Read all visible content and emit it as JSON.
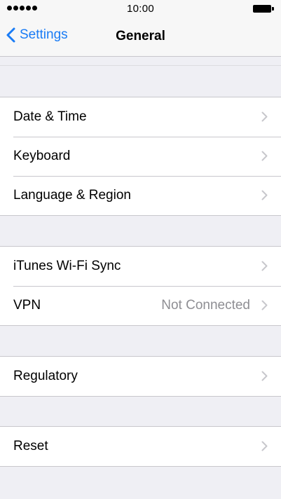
{
  "status_bar": {
    "time": "10:00",
    "signal_icon": "signal-dots-icon",
    "battery_icon": "battery-icon"
  },
  "nav": {
    "back_label": "Settings",
    "back_icon": "chevron-left-icon",
    "title": "General",
    "accent_color": "#1a7cf5"
  },
  "groups": [
    {
      "rows": [
        {
          "label": "Date & Time",
          "value": ""
        },
        {
          "label": "Keyboard",
          "value": ""
        },
        {
          "label": "Language & Region",
          "value": ""
        }
      ]
    },
    {
      "rows": [
        {
          "label": "iTunes Wi-Fi Sync",
          "value": ""
        },
        {
          "label": "VPN",
          "value": "Not Connected"
        }
      ]
    },
    {
      "rows": [
        {
          "label": "Regulatory",
          "value": ""
        }
      ]
    },
    {
      "rows": [
        {
          "label": "Reset",
          "value": ""
        }
      ]
    }
  ]
}
